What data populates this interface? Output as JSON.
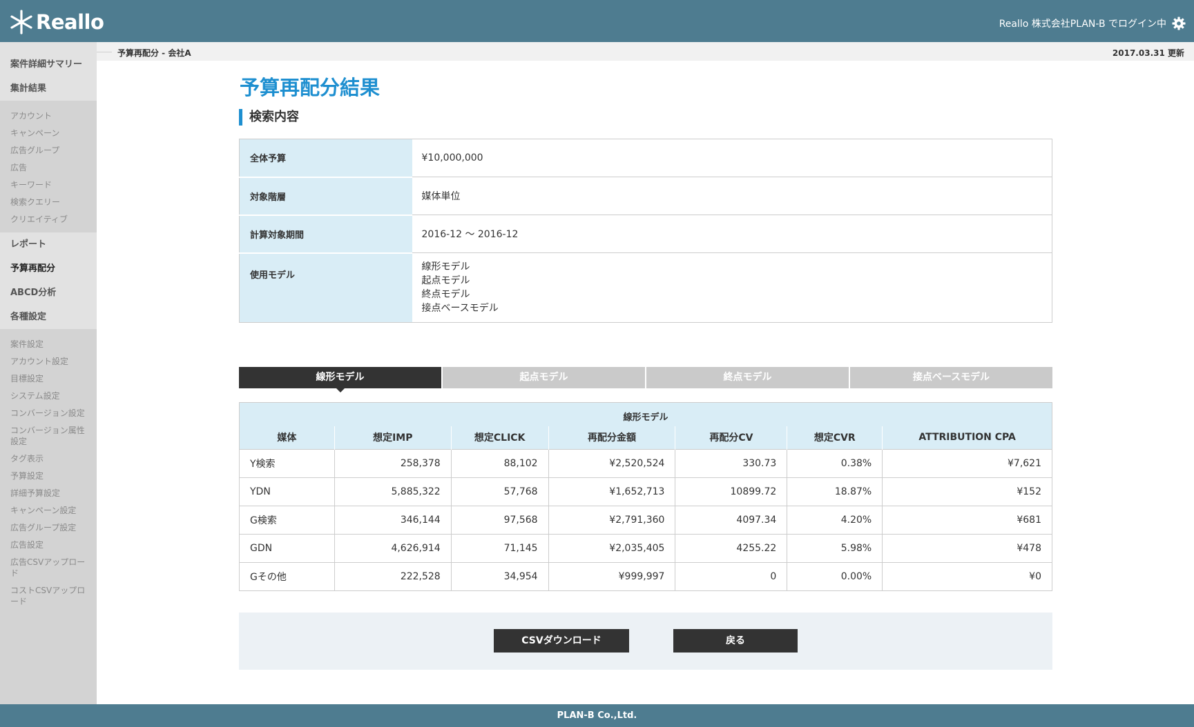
{
  "header": {
    "logo_text": "Reallo",
    "login_text": "Reallo 株式会社PLAN-B でログイン中",
    "settings_icon": "gear-icon"
  },
  "sidebar": {
    "top": [
      "案件詳細サマリー",
      "集計結果"
    ],
    "group1": [
      "アカウント",
      "キャンペーン",
      "広告グループ",
      "広告",
      "キーワード",
      "検索クエリー",
      "クリエイティブ"
    ],
    "middle": [
      "レポート",
      "予算再配分",
      "ABCD分析",
      "各種設定"
    ],
    "group2": [
      "案件設定",
      "アカウント設定",
      "目標設定",
      "システム設定",
      "コンバージョン設定",
      "コンバージョン属性設定",
      "タグ表示",
      "予算設定",
      "詳細予算設定",
      "キャンペーン設定",
      "広告グループ設定",
      "広告設定",
      "広告CSVアップロード",
      "コストCSVアップロード"
    ]
  },
  "breadcrumb": "予算再配分 - 会社A",
  "updated": "2017.03.31 更新",
  "page_title": "予算再配分結果",
  "section_title": "検索内容",
  "search_info": {
    "budget_label": "全体予算",
    "budget_value": "¥10,000,000",
    "level_label": "対象階層",
    "level_value": "媒体単位",
    "period_label": "計算対象期間",
    "period_value": "2016-12 〜 2016-12",
    "model_label": "使用モデル",
    "models": [
      "線形モデル",
      "起点モデル",
      "終点モデル",
      "接点ベースモデル"
    ]
  },
  "tabs": [
    "線形モデル",
    "起点モデル",
    "終点モデル",
    "接点ベースモデル"
  ],
  "result_table": {
    "caption": "線形モデル",
    "headers": [
      "媒体",
      "想定IMP",
      "想定CLICK",
      "再配分金額",
      "再配分CV",
      "想定CVR",
      "ATTRIBUTION CPA"
    ],
    "rows": [
      [
        "Y検索",
        "258,378",
        "88,102",
        "¥2,520,524",
        "330.73",
        "0.38%",
        "¥7,621"
      ],
      [
        "YDN",
        "5,885,322",
        "57,768",
        "¥1,652,713",
        "10899.72",
        "18.87%",
        "¥152"
      ],
      [
        "G検索",
        "346,144",
        "97,568",
        "¥2,791,360",
        "4097.34",
        "4.20%",
        "¥681"
      ],
      [
        "GDN",
        "4,626,914",
        "71,145",
        "¥2,035,405",
        "4255.22",
        "5.98%",
        "¥478"
      ],
      [
        "Gその他",
        "222,528",
        "34,954",
        "¥999,997",
        "0",
        "0.00%",
        "¥0"
      ]
    ]
  },
  "buttons": {
    "csv": "CSVダウンロード",
    "back": "戻る"
  },
  "footer": "PLAN-B Co.,Ltd."
}
